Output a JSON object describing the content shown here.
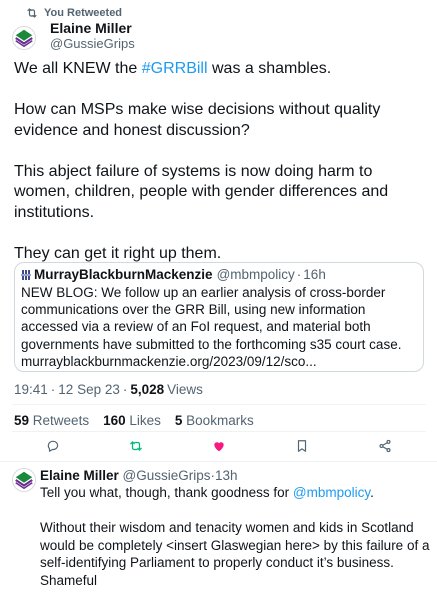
{
  "retweet_bar": {
    "label": "You Retweeted"
  },
  "tweet": {
    "author_name": "Elaine Miller",
    "author_handle": "@GussieGrips",
    "line1_before": "We all KNEW the ",
    "hashtag": "#GRRBill",
    "line1_after": " was a shambles.",
    "paragraph2": "How can MSPs make wise decisions without quality evidence and honest discussion?",
    "paragraph3": "This abject failure of systems is now doing harm to women, children, people with gender differences and institutions.",
    "paragraph4": "They can get it right up them.",
    "time": "19:41",
    "date": "12 Sep 23",
    "views_count": "5,028",
    "views_label": "Views",
    "dot": "·",
    "retweets_count": "59",
    "retweets_label": "Retweets",
    "likes_count": "160",
    "likes_label": "Likes",
    "bookmarks_count": "5",
    "bookmarks_label": "Bookmarks"
  },
  "quote": {
    "author_name": "MurrayBlackburnMackenzie",
    "author_handle": "@mbmpolicy",
    "time": "16h",
    "dot": "·",
    "body": "NEW BLOG:  We follow up an earlier analysis of cross-border communications over the GRR Bill, using new information accessed via a review of an FoI request, and material both governments have submitted to the forthcoming  s35 court case. murrayblackburnmackenzie.org/2023/09/12/sco..."
  },
  "reply": {
    "author_name": "Elaine Miller",
    "author_handle": "@GussieGrips",
    "time": "13h",
    "dot": "·",
    "line1_before": "Tell you what, though, thank  goodness for ",
    "mention": "@mbmpolicy",
    "line1_after": ".",
    "paragraph2": "Without their wisdom and tenacity women and kids in Scotland would be completely <insert Glaswegian here> by this failure of a self-identifying Parliament to properly conduct it’s business. Shameful"
  },
  "actions": [
    {
      "name": "reply-icon",
      "color": "#536471"
    },
    {
      "name": "retweet-icon",
      "color": "#00ba7c"
    },
    {
      "name": "like-icon",
      "color": "#f91880"
    },
    {
      "name": "bookmark-icon",
      "color": "#536471"
    },
    {
      "name": "share-icon",
      "color": "#536471"
    }
  ],
  "colors": {
    "link": "#1d9bf0",
    "secondary_text": "#536471",
    "primary_text": "#0f1419",
    "retweet_active": "#00ba7c",
    "like_active": "#f91880"
  }
}
